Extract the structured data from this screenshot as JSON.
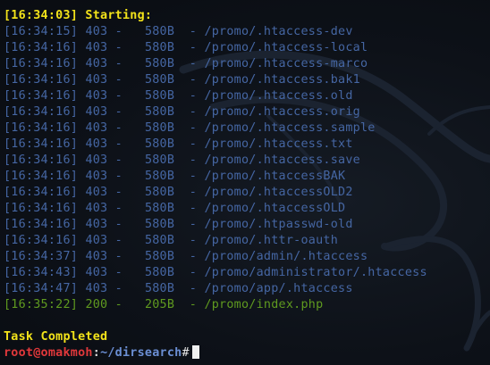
{
  "start_line": "[16:34:03] Starting:",
  "rows": [
    {
      "time": "[16:34:15]",
      "status": "403",
      "size": "580B",
      "path": "/promo/.htaccess-dev",
      "color": "#4566a3"
    },
    {
      "time": "[16:34:16]",
      "status": "403",
      "size": "580B",
      "path": "/promo/.htaccess-local",
      "color": "#4566a3"
    },
    {
      "time": "[16:34:16]",
      "status": "403",
      "size": "580B",
      "path": "/promo/.htaccess-marco",
      "color": "#4566a3"
    },
    {
      "time": "[16:34:16]",
      "status": "403",
      "size": "580B",
      "path": "/promo/.htaccess.bak1",
      "color": "#4566a3"
    },
    {
      "time": "[16:34:16]",
      "status": "403",
      "size": "580B",
      "path": "/promo/.htaccess.old",
      "color": "#4566a3"
    },
    {
      "time": "[16:34:16]",
      "status": "403",
      "size": "580B",
      "path": "/promo/.htaccess.orig",
      "color": "#4566a3"
    },
    {
      "time": "[16:34:16]",
      "status": "403",
      "size": "580B",
      "path": "/promo/.htaccess.sample",
      "color": "#4566a3"
    },
    {
      "time": "[16:34:16]",
      "status": "403",
      "size": "580B",
      "path": "/promo/.htaccess.txt",
      "color": "#4566a3"
    },
    {
      "time": "[16:34:16]",
      "status": "403",
      "size": "580B",
      "path": "/promo/.htaccess.save",
      "color": "#4566a3"
    },
    {
      "time": "[16:34:16]",
      "status": "403",
      "size": "580B",
      "path": "/promo/.htaccessBAK",
      "color": "#4566a3"
    },
    {
      "time": "[16:34:16]",
      "status": "403",
      "size": "580B",
      "path": "/promo/.htaccessOLD2",
      "color": "#4566a3"
    },
    {
      "time": "[16:34:16]",
      "status": "403",
      "size": "580B",
      "path": "/promo/.htaccessOLD",
      "color": "#4566a3"
    },
    {
      "time": "[16:34:16]",
      "status": "403",
      "size": "580B",
      "path": "/promo/.htpasswd-old",
      "color": "#4566a3"
    },
    {
      "time": "[16:34:16]",
      "status": "403",
      "size": "580B",
      "path": "/promo/.httr-oauth",
      "color": "#4566a3"
    },
    {
      "time": "[16:34:37]",
      "status": "403",
      "size": "580B",
      "path": "/promo/admin/.htaccess",
      "color": "#4566a3"
    },
    {
      "time": "[16:34:43]",
      "status": "403",
      "size": "580B",
      "path": "/promo/administrator/.htaccess",
      "color": "#4566a3"
    },
    {
      "time": "[16:34:47]",
      "status": "403",
      "size": "580B",
      "path": "/promo/app/.htaccess",
      "color": "#4566a3"
    },
    {
      "time": "[16:35:22]",
      "status": "200",
      "size": "205B",
      "path": "/promo/index.php",
      "color": "#5f9a1f"
    }
  ],
  "completion": "Task Completed",
  "prompt": {
    "user_host": "root@omakmoh",
    "separator": ":",
    "path": "~/dirsearch",
    "symbol": "#"
  },
  "colors": {
    "background": "#0c1016",
    "highlight": "#f2e21a",
    "forbidden": "#4566a3",
    "success": "#5f9a1f",
    "user": "#e0383b",
    "path": "#6b8fd4"
  },
  "icons": {
    "watermark": "kali-dragon-icon",
    "cursor": "block-cursor"
  }
}
